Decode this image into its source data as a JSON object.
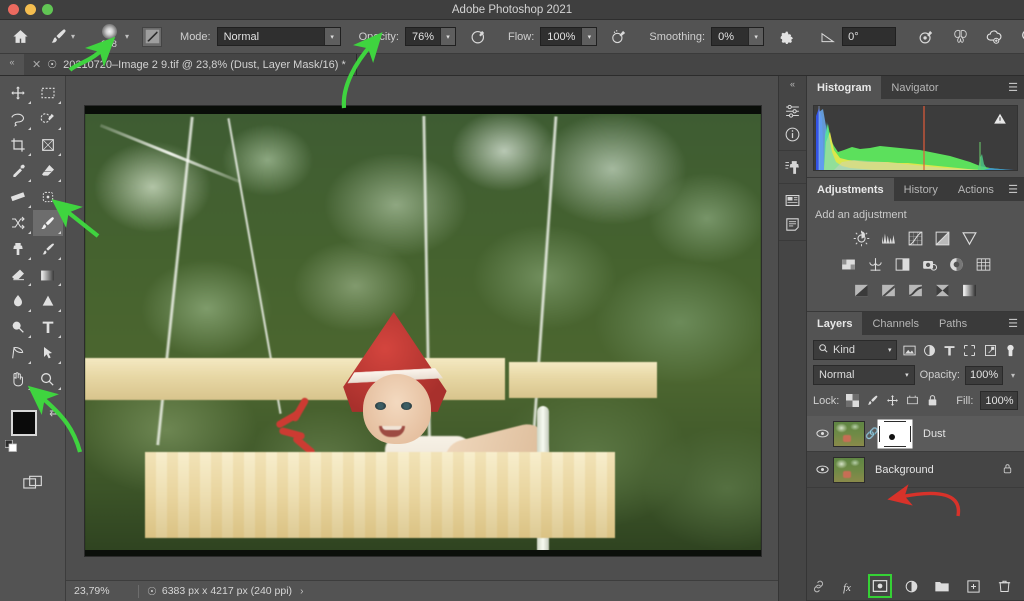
{
  "window": {
    "title": "Adobe Photoshop 2021",
    "traffic_lights": [
      "close",
      "minimize",
      "maximize"
    ]
  },
  "options_bar": {
    "home_icon": "home-icon",
    "brush_tool_icon": "brush-icon",
    "brush_size": "348",
    "brush_preset_picker_icon": "soft-round-brush-icon",
    "brush_settings_toggle_icon": "brush-panel-toggle-icon",
    "mode_label": "Mode:",
    "mode_value": "Normal",
    "opacity_label": "Opacity:",
    "opacity_value": "76%",
    "pressure_opacity_icon": "pressure-opacity-icon",
    "flow_label": "Flow:",
    "flow_value": "100%",
    "airbrush_icon": "airbrush-icon",
    "smoothing_label": "Smoothing:",
    "smoothing_value": "0%",
    "smoothing_options_icon": "gear-icon",
    "angle_icon": "angle-icon",
    "angle_value": "0°",
    "pressure_size_icon": "pressure-size-icon",
    "symmetry_icon": "symmetry-butterfly-icon",
    "search_icon": "search-icon",
    "workspace_icon": "workspace-layout-icon",
    "workspace_chevron": "chevron-down-icon",
    "share_icon": "share-upload-icon",
    "cloud_doc_icon": "cloud-document-icon"
  },
  "document_tab": {
    "close_icon": "close-icon",
    "cloud_icon": "cloud-icon",
    "title": "20210720–Image 2 9.tif @ 23,8% (Dust, Layer Mask/16) *",
    "collapse_icon": "collapse-panel-icon"
  },
  "tools": {
    "items": [
      {
        "name": "move-tool",
        "glyph": "move"
      },
      {
        "name": "rectangular-marquee-tool",
        "glyph": "marquee"
      },
      {
        "name": "lasso-tool",
        "glyph": "lasso"
      },
      {
        "name": "object-selection-tool",
        "glyph": "quickselect"
      },
      {
        "name": "crop-tool",
        "glyph": "crop"
      },
      {
        "name": "frame-tool",
        "glyph": "frame"
      },
      {
        "name": "eyedropper-tool",
        "glyph": "eyedropper"
      },
      {
        "name": "spot-healing-brush-tool",
        "glyph": "healing"
      },
      {
        "name": "ruler-tool",
        "glyph": "ruler"
      },
      {
        "name": "patch-tool",
        "glyph": "patch"
      },
      {
        "name": "shuffle-tool",
        "glyph": "shuffle"
      },
      {
        "name": "brush-tool",
        "glyph": "brush",
        "selected": true
      },
      {
        "name": "clone-stamp-tool",
        "glyph": "stamp"
      },
      {
        "name": "history-brush-tool",
        "glyph": "historybrush"
      },
      {
        "name": "eraser-tool",
        "glyph": "eraser"
      },
      {
        "name": "gradient-tool",
        "glyph": "gradient"
      },
      {
        "name": "blur-tool",
        "glyph": "blur"
      },
      {
        "name": "dodge-tool",
        "glyph": "dodge"
      },
      {
        "name": "zoom-select-tool",
        "glyph": "magnify2"
      },
      {
        "name": "type-tool",
        "glyph": "type"
      },
      {
        "name": "pen-tool",
        "glyph": "pen"
      },
      {
        "name": "path-selection-tool",
        "glyph": "pathselect"
      },
      {
        "name": "hand-tool",
        "glyph": "hand"
      },
      {
        "name": "zoom-tool",
        "glyph": "magnify"
      }
    ],
    "foreground_color": "#0a0a0a",
    "background_color": "#ffffff",
    "swap_icon": "swap-colors-icon",
    "default_icon": "default-colors-icon",
    "quick_mask_icon": "quick-mask-icon"
  },
  "icon_dock": {
    "items": [
      {
        "name": "adjustments-dock-icon"
      },
      {
        "name": "info-dock-icon"
      },
      {
        "name": "clone-source-dock-icon"
      },
      {
        "name": "libraries-dock-icon"
      },
      {
        "name": "properties-dock-icon"
      }
    ]
  },
  "histogram_panel": {
    "tabs": [
      {
        "label": "Histogram",
        "active": true
      },
      {
        "label": "Navigator",
        "active": false
      }
    ],
    "menu_icon": "panel-menu-icon",
    "warning_icon": "cached-data-warning-icon"
  },
  "adjustments_panel": {
    "tabs": [
      {
        "label": "Adjustments",
        "active": true
      },
      {
        "label": "History",
        "active": false
      },
      {
        "label": "Actions",
        "active": false
      }
    ],
    "menu_icon": "panel-menu-icon",
    "hint": "Add an adjustment",
    "rows": [
      [
        {
          "name": "brightness-contrast-adjustment-icon"
        },
        {
          "name": "levels-adjustment-icon"
        },
        {
          "name": "curves-adjustment-icon"
        },
        {
          "name": "exposure-adjustment-icon"
        },
        {
          "name": "vibrance-adjustment-icon"
        }
      ],
      [
        {
          "name": "hue-saturation-adjustment-icon"
        },
        {
          "name": "color-balance-adjustment-icon"
        },
        {
          "name": "black-white-adjustment-icon"
        },
        {
          "name": "photo-filter-adjustment-icon"
        },
        {
          "name": "channel-mixer-adjustment-icon"
        },
        {
          "name": "color-lookup-adjustment-icon"
        }
      ],
      [
        {
          "name": "invert-adjustment-icon"
        },
        {
          "name": "posterize-adjustment-icon"
        },
        {
          "name": "threshold-adjustment-icon"
        },
        {
          "name": "selective-color-adjustment-icon"
        },
        {
          "name": "gradient-map-adjustment-icon"
        }
      ]
    ]
  },
  "layers_panel": {
    "tabs": [
      {
        "label": "Layers",
        "active": true
      },
      {
        "label": "Channels",
        "active": false
      },
      {
        "label": "Paths",
        "active": false
      }
    ],
    "menu_icon": "panel-menu-icon",
    "filter": {
      "search_icon": "search-icon",
      "kind_label": "Kind",
      "chevron": "chevron-down-icon",
      "filter_icons": [
        {
          "name": "filter-pixel-icon"
        },
        {
          "name": "filter-adjustment-icon"
        },
        {
          "name": "filter-type-icon"
        },
        {
          "name": "filter-shape-icon"
        },
        {
          "name": "filter-smart-object-icon"
        },
        {
          "name": "filter-toggle-icon"
        }
      ]
    },
    "blend_mode": "Normal",
    "opacity_label": "Opacity:",
    "opacity_value": "100%",
    "lock_label": "Lock:",
    "lock_icons": [
      {
        "name": "lock-transparent-pixels-icon"
      },
      {
        "name": "lock-image-pixels-icon"
      },
      {
        "name": "lock-position-icon"
      },
      {
        "name": "lock-artboard-nesting-icon"
      },
      {
        "name": "lock-all-icon"
      }
    ],
    "fill_label": "Fill:",
    "fill_value": "100%",
    "layers": [
      {
        "name": "Dust",
        "visible": true,
        "selected": true,
        "has_mask": true,
        "linked": true,
        "locked": false
      },
      {
        "name": "Background",
        "visible": true,
        "selected": false,
        "has_mask": false,
        "linked": false,
        "locked": true
      }
    ],
    "footer_buttons": [
      {
        "name": "link-layers-button",
        "label": "GD",
        "highlighted": false
      },
      {
        "name": "layer-style-button",
        "label": "fx",
        "highlighted": false
      },
      {
        "name": "add-layer-mask-button",
        "label": "",
        "highlighted": true
      },
      {
        "name": "new-adjustment-layer-button",
        "label": "",
        "highlighted": false
      },
      {
        "name": "new-group-button",
        "label": "",
        "highlighted": false
      },
      {
        "name": "new-layer-button",
        "label": "",
        "highlighted": false
      },
      {
        "name": "delete-layer-button",
        "label": "",
        "highlighted": false
      }
    ]
  },
  "status_bar": {
    "zoom": "23,79%",
    "doc_icon": "document-dimensions-icon",
    "dimensions": "6383 px x 4217 px (240 ppi)",
    "expand_icon": "expand-status-icon"
  },
  "annotations": {
    "color": "#3fd43f",
    "arrows": [
      {
        "name": "arrow-to-brush-size",
        "target": "brush size 348"
      },
      {
        "name": "arrow-to-opacity",
        "target": "Opacity 76%"
      },
      {
        "name": "arrow-to-brush-tool",
        "target": "Brush tool"
      },
      {
        "name": "arrow-to-foreground-color",
        "target": "foreground color swatch"
      }
    ],
    "red_color": "#d8322a",
    "red_arrows": [
      {
        "name": "red-arrow-to-layer-mask",
        "target": "Dust layer mask thumbnail"
      }
    ],
    "highlight_boxes": [
      {
        "name": "highlight-add-layer-mask-button",
        "color": "#35d135"
      }
    ]
  },
  "canvas": {
    "image_description": "vintage photo of a child in a red pointed hat sitting in a wooden swing with green foliage background",
    "zoom_percent": "23,8%"
  },
  "colors": {
    "chrome_bg": "#535353",
    "panel_bg": "#454545",
    "titlebar_bg": "#3f3f3f",
    "field_bg": "#2f2f2f",
    "text": "#cfcfcf",
    "accent_green": "#3fd43f",
    "accent_red": "#d8322a"
  }
}
